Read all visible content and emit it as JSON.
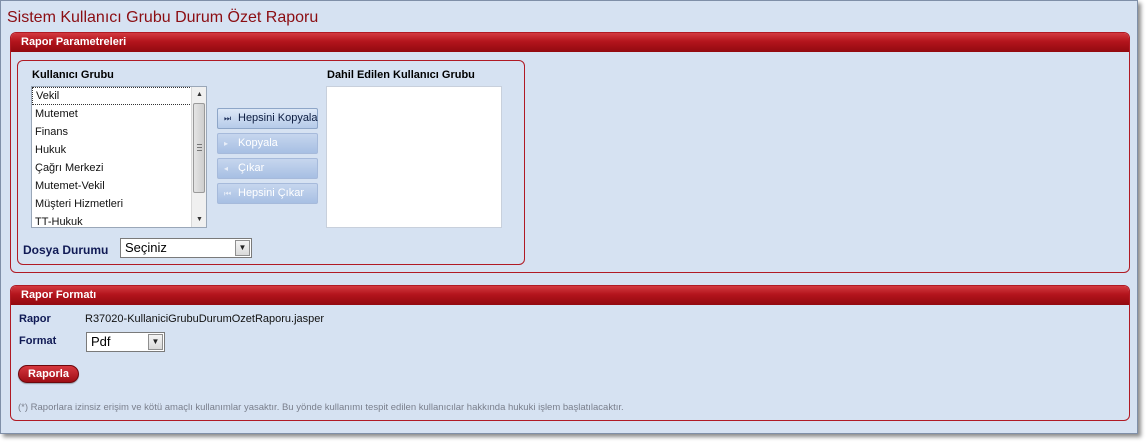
{
  "page": {
    "title": "Sistem Kullanıcı Grubu Durum Özet Raporu"
  },
  "params_panel": {
    "header": "Rapor Parametreleri",
    "source_label": "Kullanıcı Grubu",
    "target_label": "Dahil Edilen Kullanıcı Grubu",
    "source_items": [
      "Vekil",
      "Mutemet",
      "Finans",
      "Hukuk",
      "Çağrı Merkezi",
      "Mutemet-Vekil",
      "Müşteri Hizmetleri",
      "TT-Hukuk"
    ],
    "target_items": [],
    "buttons": {
      "copy_all": "Hepsini Kopyala",
      "copy": "Kopyala",
      "remove": "Çıkar",
      "remove_all": "Hepsini Çıkar"
    },
    "file_status_label": "Dosya Durumu",
    "file_status_value": "Seçiniz"
  },
  "format_panel": {
    "header": "Rapor Formatı",
    "report_label": "Rapor",
    "report_value": "R37020-KullaniciGrubuDurumOzetRaporu.jasper",
    "format_label": "Format",
    "format_value": "Pdf",
    "run_button": "Raporla",
    "footnote": "(*) Raporlara izinsiz erişim ve kötü amaçlı kullanımlar yasaktır. Bu yönde kullanımı tespit edilen kullanıcılar hakkında hukuki işlem başlatılacaktır."
  },
  "icons": {
    "scroll_up": "up-arrow-icon",
    "scroll_down": "down-arrow-icon",
    "copy_all": "fast-forward-icon",
    "copy": "play-icon",
    "remove": "reverse-play-icon",
    "remove_all": "rewind-icon",
    "dropdown": "chevron-down-icon"
  },
  "colors": {
    "accent": "#b3141c",
    "background": "#d6e2f2",
    "title": "#8b0d12"
  }
}
